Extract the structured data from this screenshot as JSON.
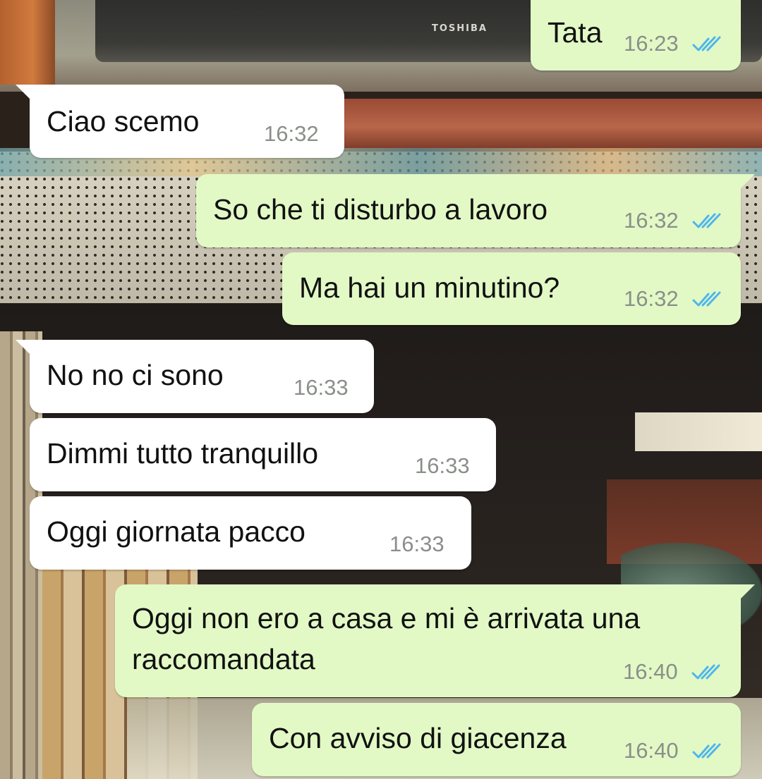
{
  "chat": {
    "messages": [
      {
        "direction": "outgoing",
        "text": "Tata",
        "time": "16:23",
        "status": "read"
      },
      {
        "direction": "incoming",
        "text": "Ciao scemo",
        "time": "16:32"
      },
      {
        "direction": "outgoing",
        "text": "So che ti disturbo a lavoro",
        "time": "16:32",
        "status": "read"
      },
      {
        "direction": "outgoing",
        "text": "Ma hai un minutino?",
        "time": "16:32",
        "status": "read"
      },
      {
        "direction": "incoming",
        "text": "No no ci sono",
        "time": "16:33"
      },
      {
        "direction": "incoming",
        "text": "Dimmi tutto tranquillo",
        "time": "16:33"
      },
      {
        "direction": "incoming",
        "text": "Oggi giornata pacco",
        "time": "16:33"
      },
      {
        "direction": "outgoing",
        "text_lines": [
          "Oggi non ero a casa e mi è arrivata una",
          "raccomandata"
        ],
        "time": "16:40",
        "status": "read"
      },
      {
        "direction": "outgoing",
        "text": "Con avviso di giacenza",
        "time": "16:40",
        "status": "read"
      }
    ],
    "colors": {
      "incoming_bubble": "#ffffff",
      "outgoing_bubble": "#e2f9c6",
      "timestamp": "#8a8f89",
      "read_ticks": "#4fb6ec"
    },
    "icons": {
      "read_receipt": "double-check-icon"
    }
  },
  "wallpaper": {
    "tv_brand": "TOSHIBA"
  }
}
